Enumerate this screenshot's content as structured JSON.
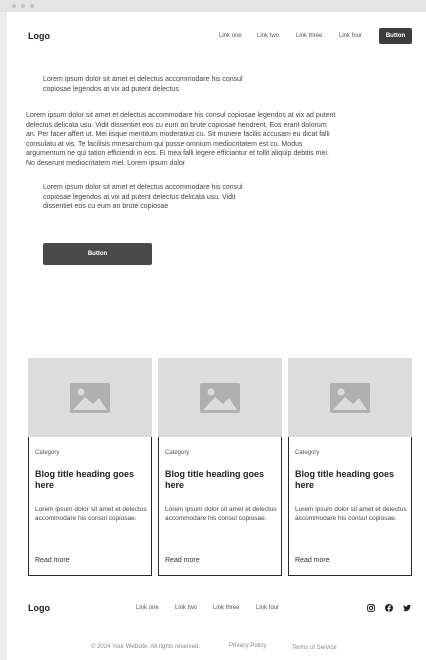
{
  "header": {
    "logo": "Logo",
    "nav": [
      "Link one",
      "Link two",
      "Link three",
      "Link four"
    ],
    "button_label": "Button"
  },
  "hero": {
    "para1": "Lorem ipsum dolor sit amet et delectus accommodare his consul copiosae legendos at vix ad putent delectus",
    "para2": "Lorem ipsum dolor sit amet et delectus accommodare his consul copiosae legendos at vix ad putent delectus delicata usu. Vidit dissentiet eos cu eum an brute copiosae hendrerit. Eos erant dolorum an. Per facer affert ut. Mei iisque mentitum moderatius cu. Sit munere facilis accusam eu dicat falli consulatu at vis. Te facilisis mnesarchum qui posse omnium mediocritatem est cu. Modus argumentum ne qui tation efficiendi in eos. Ei mea falli legere efficiantur et tollit aliquip debitis mei. No deserunt mediocritatem mel. Lorem ipsum dolor",
    "para3": "Lorem ipsum dolor sit amet et delectus accommodare his consul copiosae legendos at vix ad putent delectus delicata usu. Vidit dissentiet eos cu eum an brute copiosae",
    "button_label": "Button"
  },
  "blog": {
    "cards": [
      {
        "category": "Category",
        "title": "Blog title heading goes here",
        "excerpt": "Lorem ipsum dolor sit amet et delectus accommodare his consul copiosae.",
        "link": "Read more",
        "image_icon": "image-placeholder-icon"
      },
      {
        "category": "Category",
        "title": "Blog title heading goes here",
        "excerpt": "Lorem ipsum dolor sit amet et delectus accommodare his consul copiosae.",
        "link": "Read more",
        "image_icon": "image-placeholder-icon"
      },
      {
        "category": "Category",
        "title": "Blog title heading goes here",
        "excerpt": "Lorem ipsum dolor sit amet et delectus accommodare his consul copiosae.",
        "link": "Read more",
        "image_icon": "image-placeholder-icon"
      }
    ]
  },
  "footer": {
    "logo": "Logo",
    "links": [
      "Link one",
      "Link two",
      "Link three",
      "Link four"
    ],
    "social": [
      "instagram-icon",
      "facebook-icon",
      "twitter-icon"
    ],
    "copyright": "© 2024 Your Website. All rights reserved.",
    "privacy": "Privacy Policy",
    "terms": "Terms of Service"
  },
  "colors": {
    "button_bg": "#3d3d3d",
    "placeholder_bg": "#dcdcdc",
    "placeholder_icon": "#b0b0b0"
  }
}
